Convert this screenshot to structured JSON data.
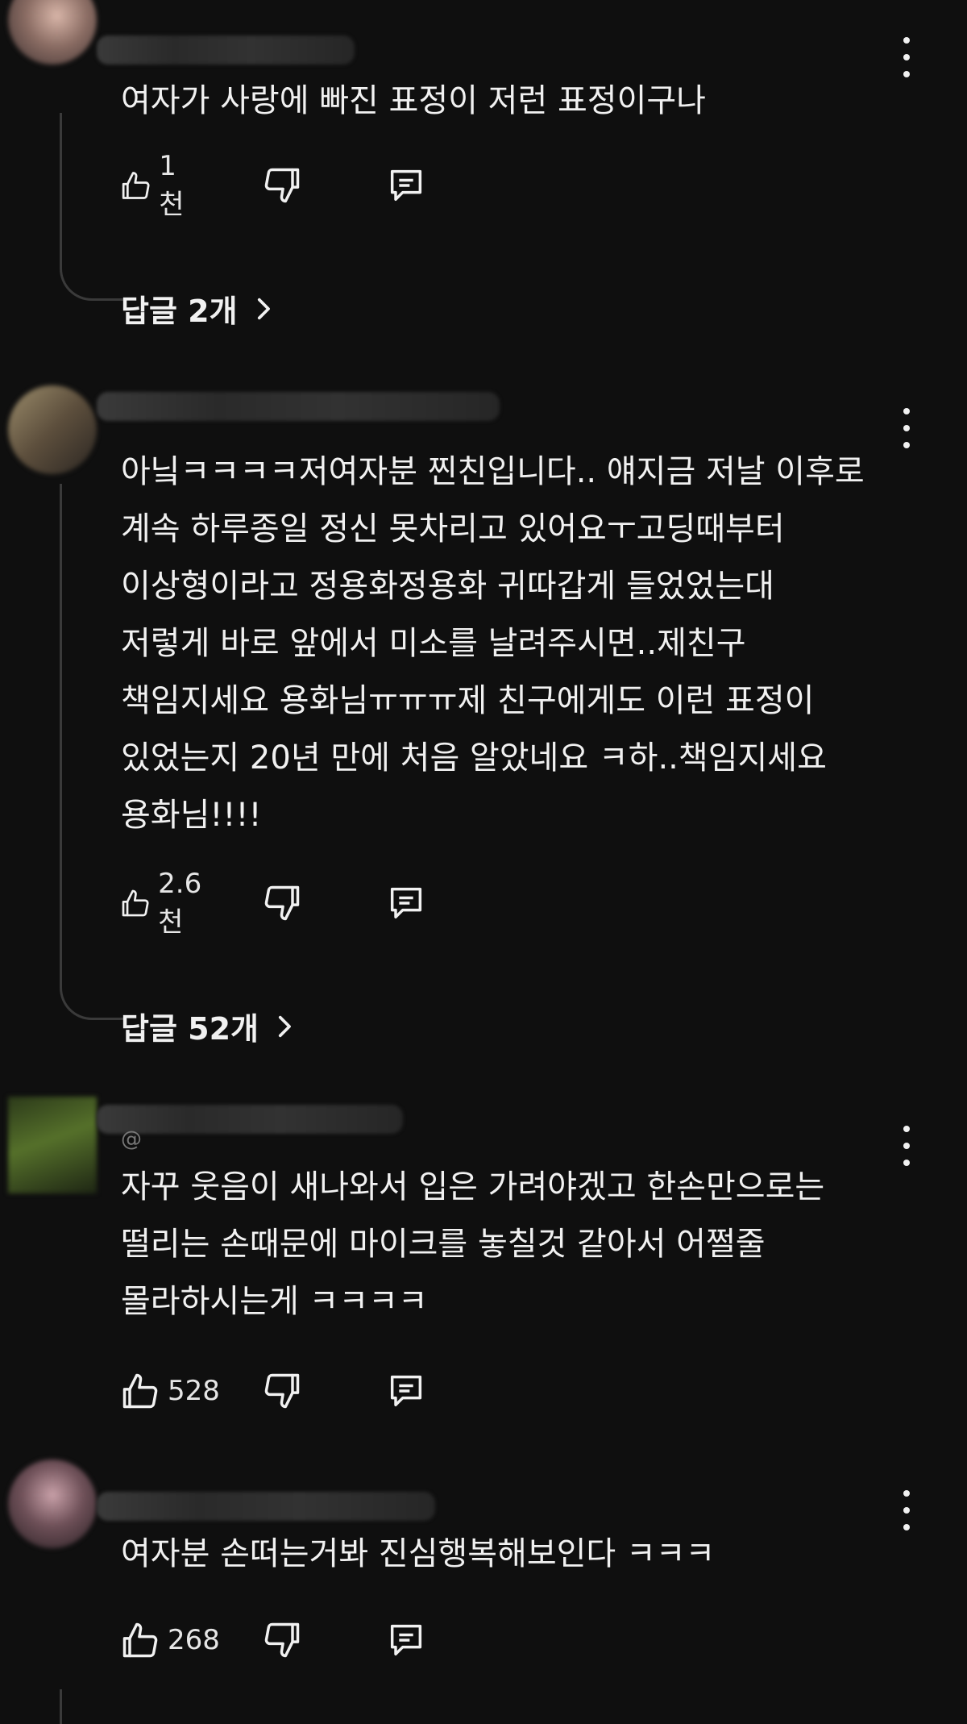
{
  "comments": [
    {
      "text": "여자가 사랑에 빠진 표정이 저런 표정이구나",
      "likes": "1천",
      "replies_label": "답글 2개"
    },
    {
      "text": "아닠ㅋㅋㅋㅋ저여자분 찐친입니다.. 얘지금 저날 이후로\n계속 하루종일 정신 못차리고 있어요ㅜ고딩때부터\n이상형이라고 정용화정용화 귀따갑게 들었었는대\n저렇게 바로 앞에서 미소를 날려주시면..제친구\n책임지세요 용화님ㅠㅠㅠ제 친구에게도 이런 표정이\n있었는지 20년 만에 처음 알았네요 ㅋ하..책임지세요\n용화님!!!!",
      "likes": "2.6천",
      "replies_label": "답글 52개"
    },
    {
      "handle_prefix": "@",
      "text": "자꾸 웃음이 새나와서 입은 가려야겠고 한손만으로는\n떨리는 손때문에 마이크를 놓칠것 같아서 어쩔줄\n몰라하시는게 ㅋㅋㅋㅋ",
      "likes": "528"
    },
    {
      "text": "여자분 손떠는거봐 진심행복해보인다 ㅋㅋㅋ",
      "likes": "268"
    }
  ],
  "icons": {
    "like": "thumbs-up-icon",
    "dislike": "thumbs-down-icon",
    "reply": "comment-icon",
    "more": "more-vert-icon",
    "chevron": "chevron-right-icon"
  },
  "colors": {
    "background": "#0f0f0f",
    "text": "#f1f1f1",
    "thread_line": "#3a3a3a"
  }
}
